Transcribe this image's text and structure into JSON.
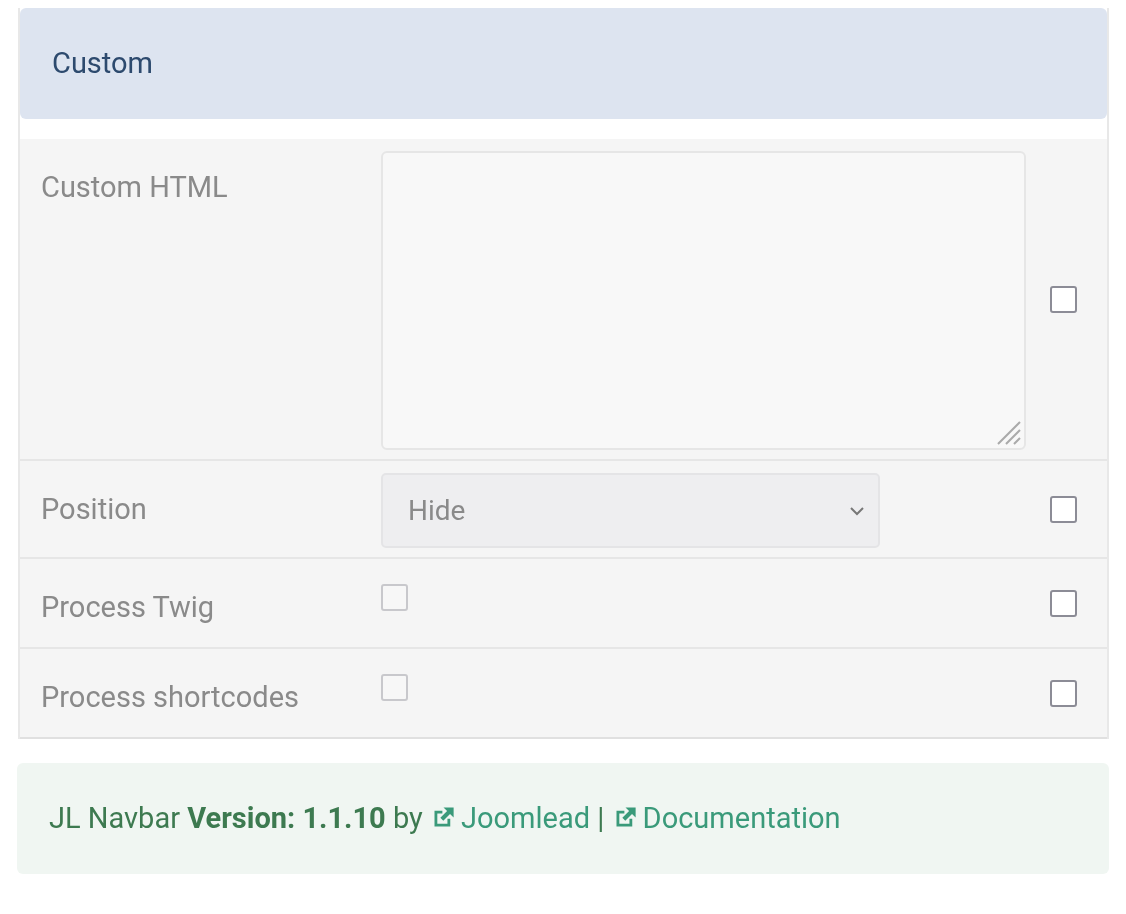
{
  "section": {
    "title": "Custom"
  },
  "fields": [
    {
      "kind": "textarea",
      "label": "Custom HTML",
      "override_checked": false
    },
    {
      "kind": "select",
      "label": "Position",
      "value": "Hide",
      "override_checked": false
    },
    {
      "kind": "checkbox",
      "label": "Process Twig",
      "checked": false,
      "override_checked": false
    },
    {
      "kind": "checkbox",
      "label": "Process shortcodes",
      "checked": false,
      "override_checked": false
    }
  ],
  "footer": {
    "text": "JL Navbar **Version: 1.1.10** by",
    "links": [
      "Joomlead",
      "Documentation"
    ],
    "separator": "|"
  }
}
